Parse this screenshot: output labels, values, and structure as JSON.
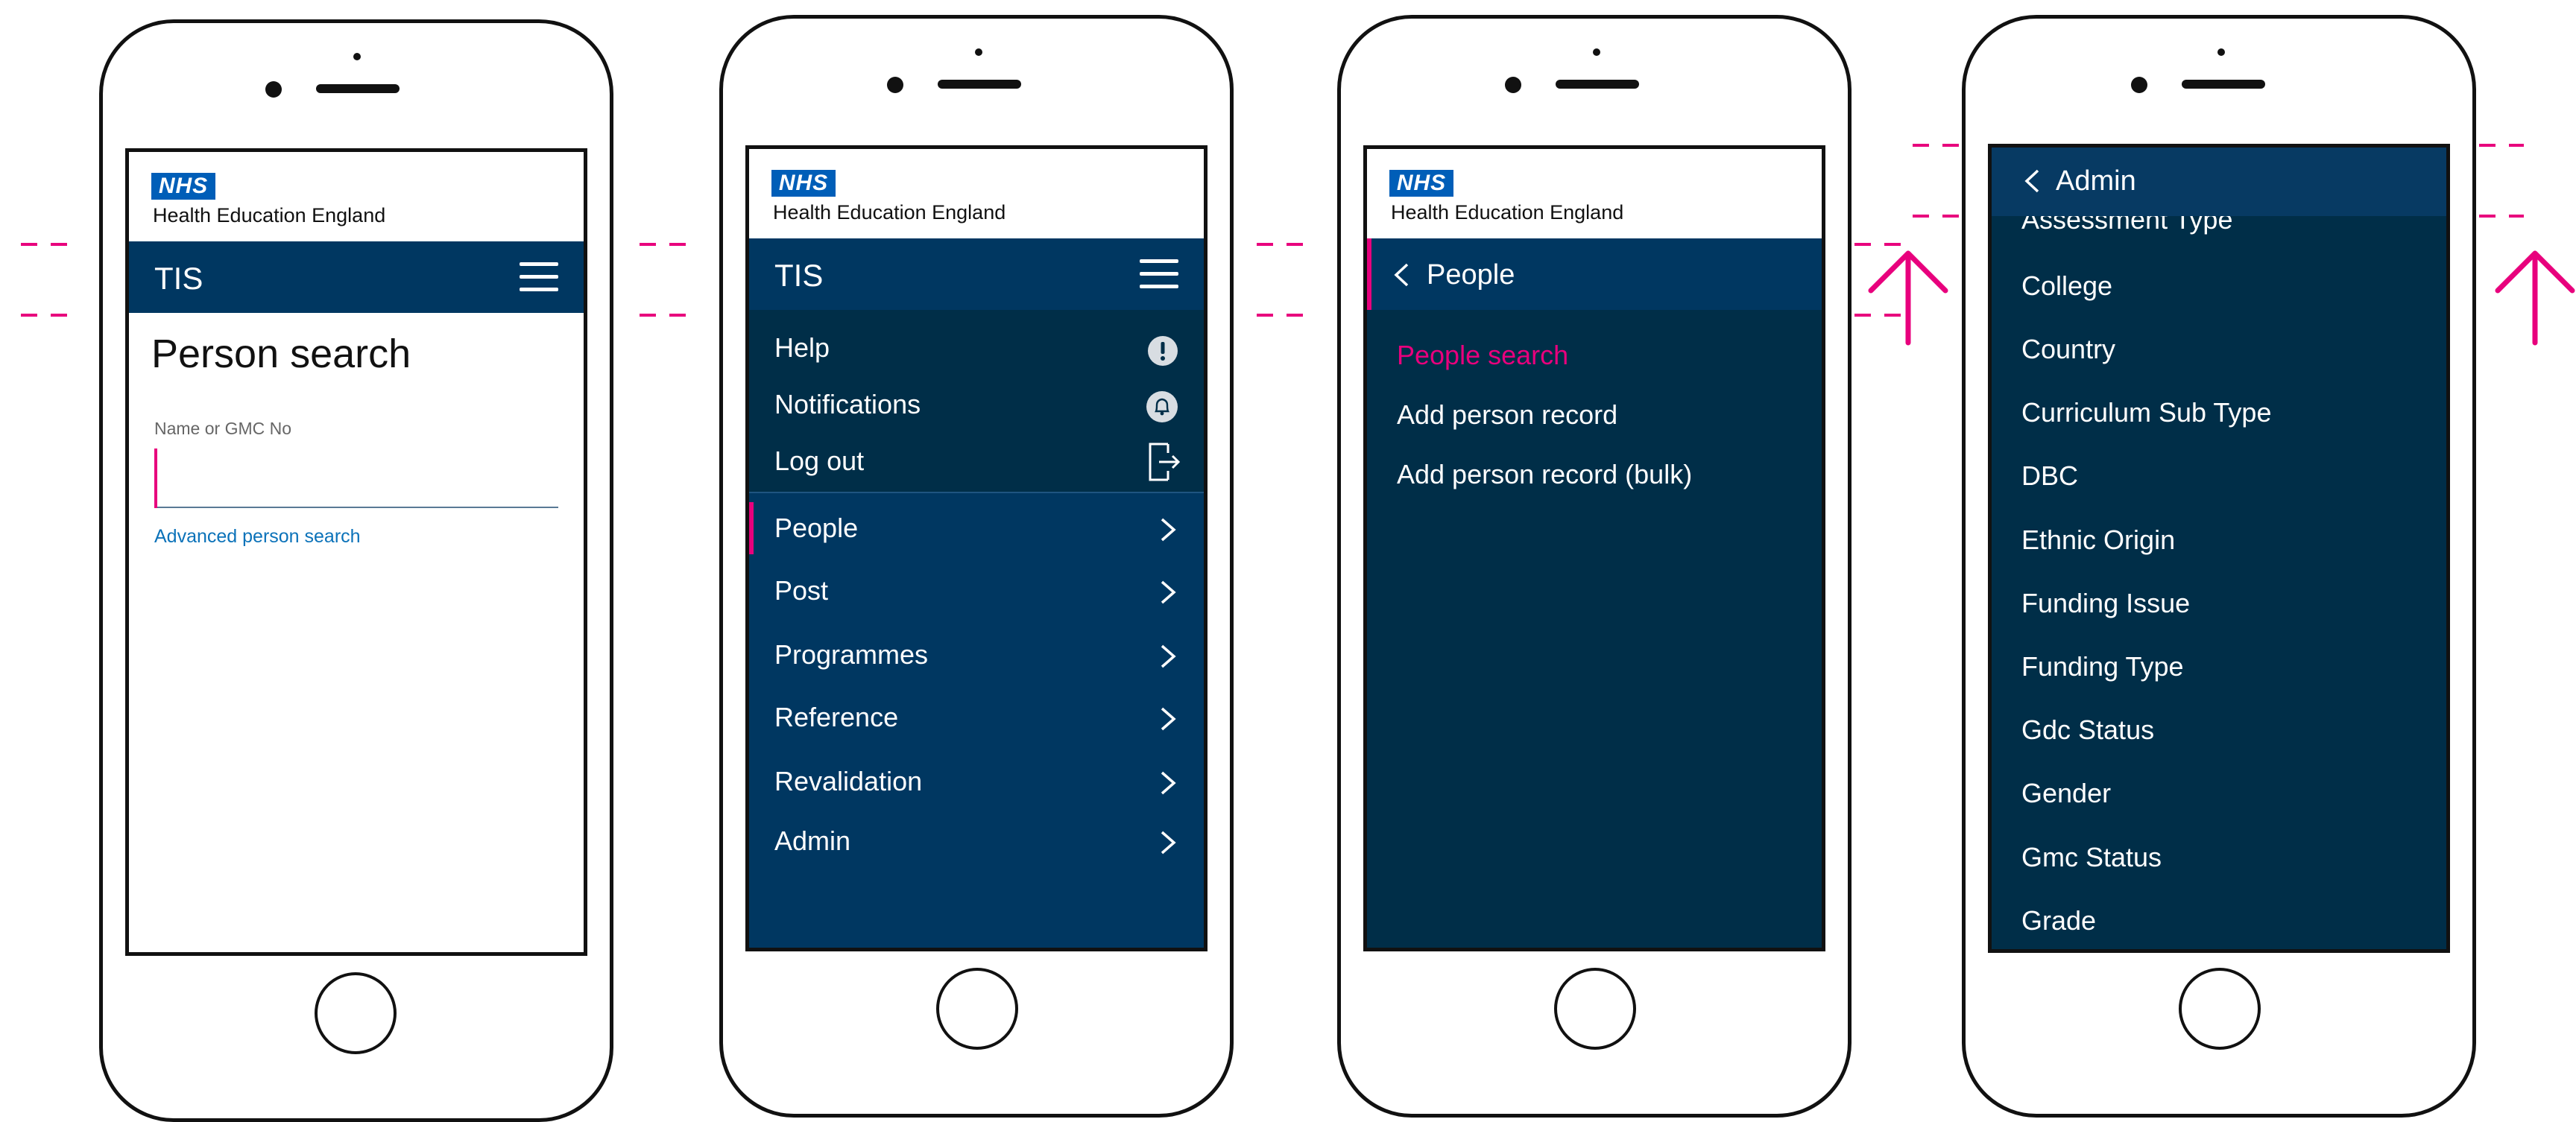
{
  "brand": {
    "logo_text": "NHS",
    "org_name": "Health Education England",
    "app_name": "TIS",
    "nhs_blue": "#005eb8",
    "navy": "#003761",
    "dark_navy": "#002e48",
    "accent": "#e8007d"
  },
  "screen1": {
    "page_title": "Person search",
    "search_label": "Name or GMC No",
    "search_value": "",
    "advanced_link": "Advanced person search"
  },
  "screen2": {
    "utility_items": [
      {
        "label": "Help",
        "icon": "alert-icon"
      },
      {
        "label": "Notifications",
        "icon": "bell-icon"
      },
      {
        "label": "Log out",
        "icon": "logout-icon"
      }
    ],
    "nav_items": [
      {
        "label": "People",
        "active": true
      },
      {
        "label": "Post"
      },
      {
        "label": "Programmes"
      },
      {
        "label": "Reference"
      },
      {
        "label": "Revalidation"
      },
      {
        "label": "Admin"
      }
    ]
  },
  "screen3": {
    "back_label": "People",
    "items": [
      "People search",
      "Add person record",
      "Add person record (bulk)"
    ]
  },
  "screen4": {
    "back_label": "Admin",
    "items": [
      "Assessment Type",
      "College",
      "Country",
      "Curriculum Sub Type",
      "DBC",
      "Ethnic Origin",
      "Funding Issue",
      "Funding Type",
      "Gdc Status",
      "Gender",
      "Gmc Status",
      "Grade"
    ]
  }
}
